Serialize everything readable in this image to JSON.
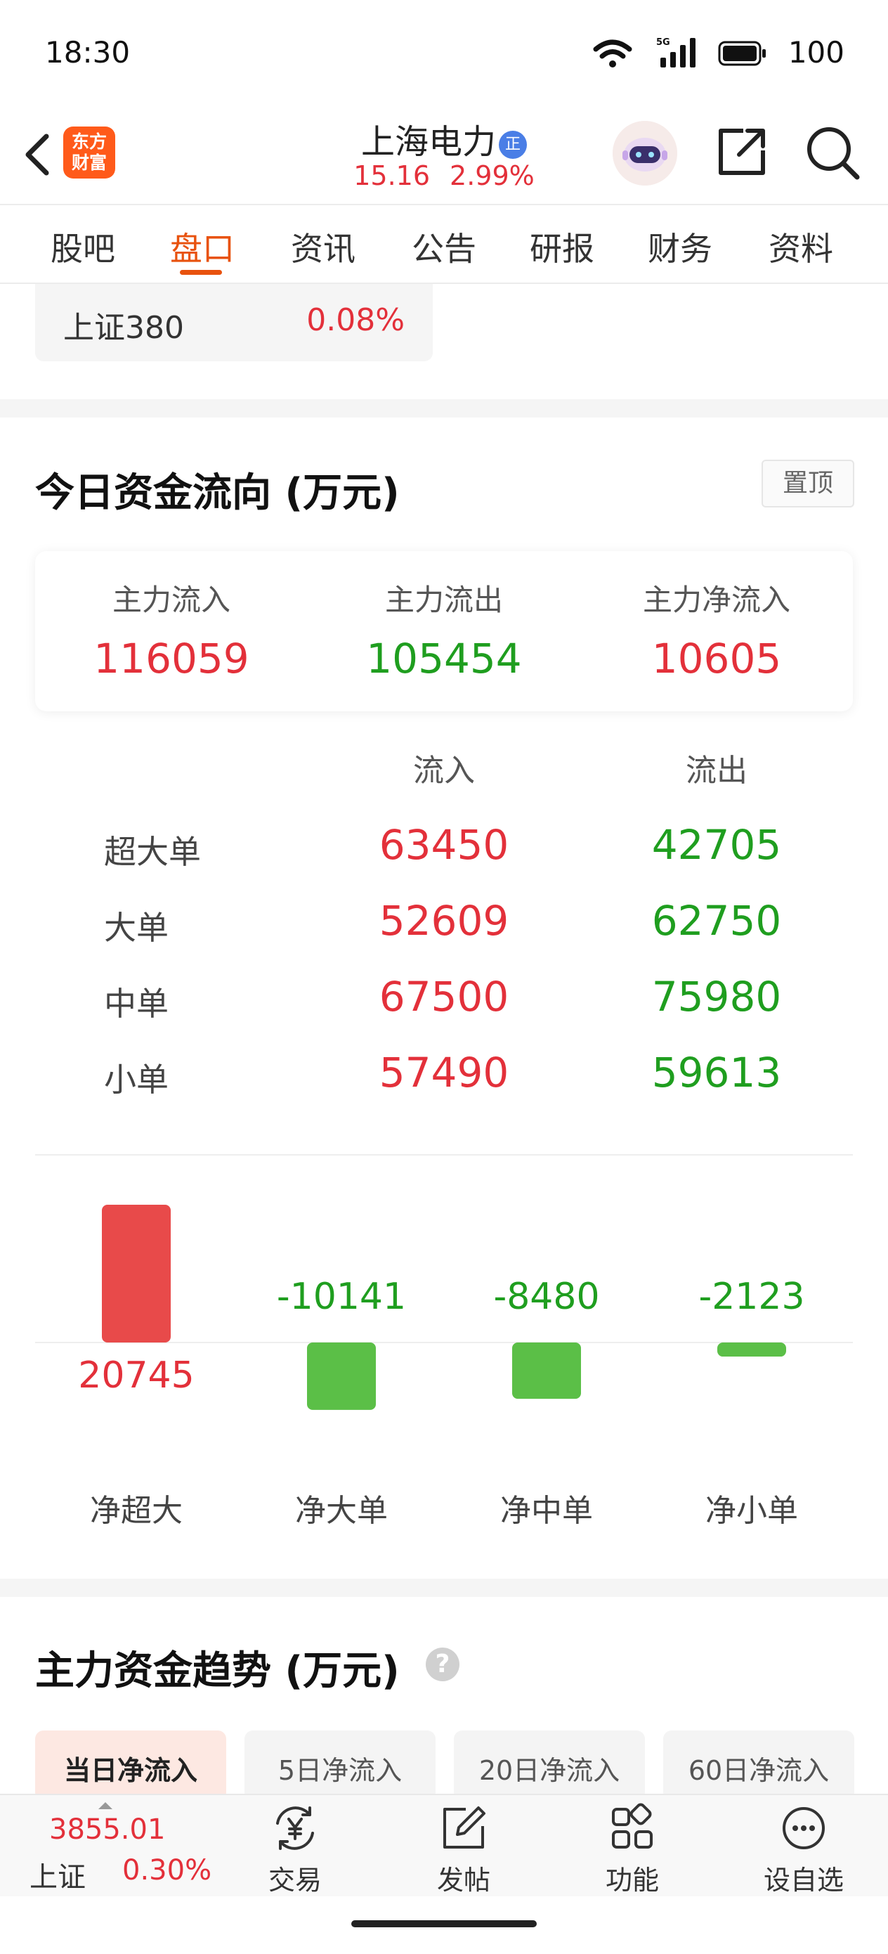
{
  "status_bar": {
    "time": "18:30",
    "network": "5G",
    "battery": "100"
  },
  "header": {
    "logo": [
      "东方",
      "财富"
    ],
    "stock_name": "上海电力",
    "badge": "正",
    "price": "15.16",
    "change_pct": "2.99%"
  },
  "tabs": [
    {
      "label": "股吧"
    },
    {
      "label": "盘口",
      "active": true
    },
    {
      "label": "资讯"
    },
    {
      "label": "公告"
    },
    {
      "label": "研报"
    },
    {
      "label": "财务"
    },
    {
      "label": "资料"
    }
  ],
  "index_chip": {
    "name": "上证380",
    "pct": "0.08%"
  },
  "fund_flow": {
    "title": "今日资金流向 (万元)",
    "pin_label": "置顶",
    "summary": [
      {
        "label": "主力流入",
        "value": "116059",
        "color": "red"
      },
      {
        "label": "主力流出",
        "value": "105454",
        "color": "green"
      },
      {
        "label": "主力净流入",
        "value": "10605",
        "color": "red"
      }
    ],
    "table_headers": {
      "inflow": "流入",
      "outflow": "流出"
    },
    "rows": [
      {
        "label": "超大单",
        "inflow": "63450",
        "outflow": "42705"
      },
      {
        "label": "大单",
        "inflow": "52609",
        "outflow": "62750"
      },
      {
        "label": "中单",
        "inflow": "67500",
        "outflow": "75980"
      },
      {
        "label": "小单",
        "inflow": "57490",
        "outflow": "59613"
      }
    ]
  },
  "chart_data": {
    "type": "bar",
    "categories": [
      "净超大",
      "净大单",
      "净中单",
      "净小单"
    ],
    "values": [
      20745,
      -10141,
      -8480,
      -2123
    ],
    "value_labels": [
      "20745",
      "-10141",
      "-8480",
      "-2123"
    ],
    "colors": {
      "positive": "#e84a4a",
      "negative": "#5bbf47"
    },
    "title": "",
    "xlabel": "",
    "ylabel": ""
  },
  "trend": {
    "title": "主力资金趋势 (万元)",
    "help": "?",
    "tabs": [
      {
        "label": "当日净流入",
        "active": true
      },
      {
        "label": "5日净流入"
      },
      {
        "label": "20日净流入"
      },
      {
        "label": "60日净流入"
      }
    ]
  },
  "bottom_bar": {
    "index_value": "3855.01",
    "index_name": "上证",
    "index_pct": "0.30%",
    "items": [
      {
        "label": "交易",
        "icon": "yen-refresh-icon"
      },
      {
        "label": "发帖",
        "icon": "edit-icon"
      },
      {
        "label": "功能",
        "icon": "grid-icon"
      },
      {
        "label": "设自选",
        "icon": "more-icon"
      }
    ]
  },
  "colors": {
    "up": "#e3303a",
    "down": "#1f9e1f",
    "accent": "#e8520e"
  }
}
